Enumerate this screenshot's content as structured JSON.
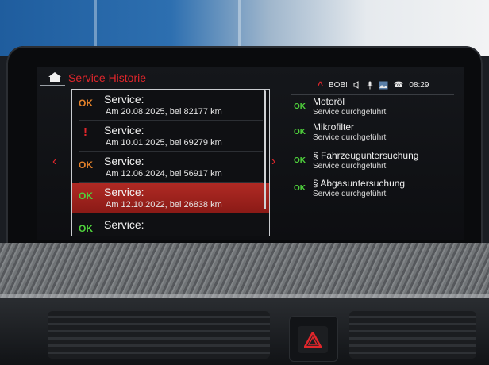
{
  "header": {
    "title": "Service Historie"
  },
  "status": {
    "user": "BOB!",
    "time": "08:29"
  },
  "service_list": [
    {
      "status": "OK",
      "label": "Service:",
      "detail": "Am 20.08.2025, bei 82177 km",
      "status_color": "#e4822b"
    },
    {
      "status": "!",
      "label": "Service:",
      "detail": "Am 10.01.2025, bei 69279 km",
      "status_color": "#e0262b"
    },
    {
      "status": "OK",
      "label": "Service:",
      "detail": "Am 12.06.2024, bei 56917 km",
      "status_color": "#e4822b"
    },
    {
      "status": "OK",
      "label": "Service:",
      "detail": "Am 12.10.2022, bei 26838 km",
      "status_color": "#4fd13c",
      "selected": true
    },
    {
      "status": "OK",
      "label": "Service:",
      "detail": "",
      "status_color": "#4fd13c"
    }
  ],
  "service_details": [
    {
      "status": "OK",
      "name": "Motoröl",
      "sub": "Service durchgeführt"
    },
    {
      "status": "OK",
      "name": "Mikrofilter",
      "sub": "Service durchgeführt"
    },
    {
      "status": "OK",
      "name": "§ Fahrzeuguntersuchung",
      "sub": "Service durchgeführt"
    },
    {
      "status": "OK",
      "name": "§ Abgasuntersuchung",
      "sub": "Service durchgeführt"
    }
  ],
  "colors": {
    "accent": "#e0262b",
    "ok_green": "#4fd13c",
    "ok_orange": "#e4822b",
    "selected_bg": "#b12a24"
  },
  "icons": {
    "home": "home-icon",
    "chevron_up": "chevron-up-icon",
    "volume": "speaker-icon",
    "microphone": "microphone-icon",
    "media": "media-icon",
    "connectivity": "phone-connection-icon",
    "nav_left": "chevron-left-icon",
    "nav_right": "chevron-right-icon",
    "hazard": "hazard-warning-icon"
  }
}
